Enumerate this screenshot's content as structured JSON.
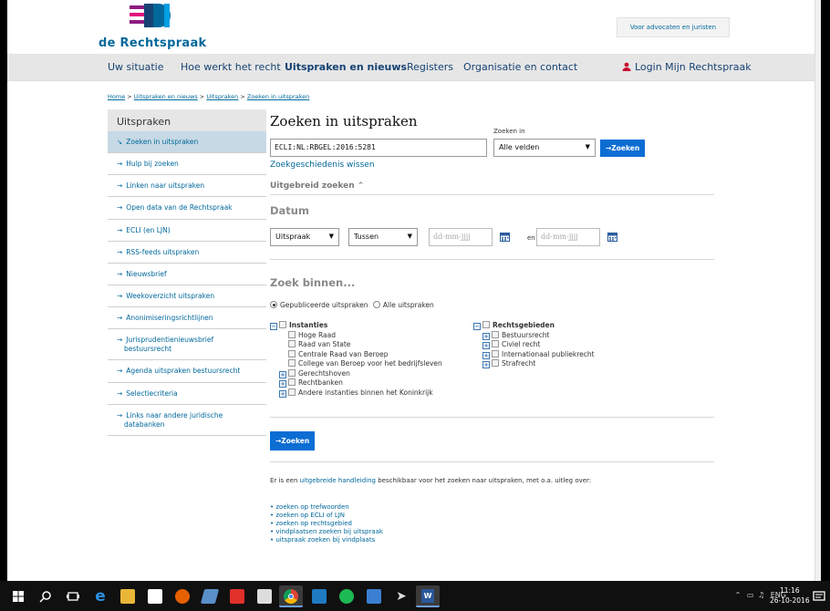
{
  "header": {
    "logo_text": "de Rechtspraak",
    "lawyers_button": "Voor advocaten en juristen"
  },
  "nav": {
    "items": [
      "Uw situatie",
      "Hoe werkt het recht",
      "Uitspraken en nieuws",
      "Registers",
      "Organisatie en contact"
    ],
    "login": "Login Mijn Rechtspraak"
  },
  "breadcrumb": {
    "items": [
      "Home",
      "Uitspraken en nieuws",
      "Uitspraken",
      "Zoeken in uitspraken"
    ],
    "sep": " > "
  },
  "sidebar": {
    "heading": "Uitspraken",
    "items": [
      "Zoeken in uitspraken",
      "Hulp bij zoeken",
      "Linken naar uitspraken",
      "Open data van de Rechtspraak",
      "ECLI (en LJN)",
      "RSS-feeds uitspraken",
      "Nieuwsbrief",
      "Weekoverzicht uitspraken",
      "Anonimiseringsrichtlijnen",
      "Jurisprudentienieuwsbrief bestuursrecht",
      "Agenda uitspraken bestuursrecht",
      "Selectiecriteria",
      "Links naar andere juridische databanken"
    ]
  },
  "main": {
    "title": "Zoeken in uitspraken",
    "search_in_label": "Zoeken in",
    "search_value": "ECLI:NL:RBGEL:2016:5281",
    "search_in_value": "Alle velden",
    "search_button": "Zoeken",
    "clear_history": "Zoekgeschiedenis wissen",
    "advanced": "Uitgebreid zoeken",
    "date_heading": "Datum",
    "date_type": "Uitspraak",
    "date_range": "Tussen",
    "date_placeholder": "dd-mm-jjjj",
    "date_and": "en",
    "within_heading": "Zoek binnen...",
    "radio_published": "Gepubliceerde uitspraken",
    "radio_all": "Alle uitspraken",
    "instanties": {
      "label": "Instanties",
      "children": [
        "Hoge Raad",
        "Raad van State",
        "Centrale Raad van Beroep",
        "College van Beroep voor het bedrijfsleven"
      ],
      "groups": [
        "Gerechtshoven",
        "Rechtbanken",
        "Andere instanties binnen het Koninkrijk"
      ]
    },
    "rechtsgebieden": {
      "label": "Rechtsgebieden",
      "groups": [
        "Bestuursrecht",
        "Civiel recht",
        "Internationaal publiekrecht",
        "Strafrecht"
      ]
    },
    "search_button_bottom": "Zoeken",
    "help_prefix": "Er is een ",
    "help_link": "uitgebreide handleiding",
    "help_suffix": " beschikbaar voor het zoeken naar uitspraken, met o.a. uitleg over:",
    "help_list": [
      "zoeken op trefwoorden",
      "zoeken op ECLI of LJN",
      "zoeken op rechtsgebied",
      "vindplaatsen zoeken bij uitspraak",
      "uitspraak zoeken bij vindplaats"
    ]
  },
  "taskbar": {
    "lang": "ENG",
    "time": "11:16",
    "date": "26-10-2016"
  }
}
